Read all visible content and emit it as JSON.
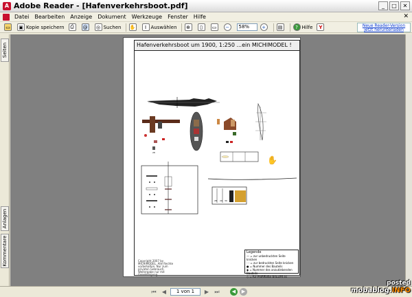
{
  "window": {
    "title": "Adobe Reader - [Hafenverkehrsboot.pdf]",
    "app_icon": "adobe-icon"
  },
  "menu": {
    "items": [
      "Datei",
      "Bearbeiten",
      "Anzeige",
      "Dokument",
      "Werkzeuge",
      "Fenster",
      "Hilfe"
    ]
  },
  "toolbar": {
    "open": "",
    "save_copy": "Kopie speichern",
    "search": "Suchen",
    "select": "Auswählen",
    "zoom_value": "58%",
    "help": "Hilfe",
    "update_link": "Neue Reader-Version jetzt herunterladen"
  },
  "sidebar": {
    "tab_pages": "Seiten",
    "tab_attachments": "Anlagen",
    "tab_comments": "Kommentare"
  },
  "document": {
    "page_title": "Hafenverkehrsboot um 1900,  1:250   ...ein MICHIMODEL !",
    "legal": "Copyright 2007 by MICHIMODEL. Alle Rechte vorbehalten. Nur zum privaten Gebrauch. Weitergabe nur mit Genehmigung.",
    "legend_title": "Legende",
    "legend_lines": [
      "— = zur unbedruckten Seite knicken",
      "- - = zur bedruckten Seite knicken",
      "● = Nummer des Bauteils",
      "◆ = Nummer des anzuklebenden Bauteils",
      "◇ = für Profilfarbe braucht es"
    ]
  },
  "status": {
    "page_indicator": "1 von 1"
  },
  "watermark": {
    "line1": "posted",
    "line2a": "mobablog.",
    "line2b": "INFO"
  }
}
